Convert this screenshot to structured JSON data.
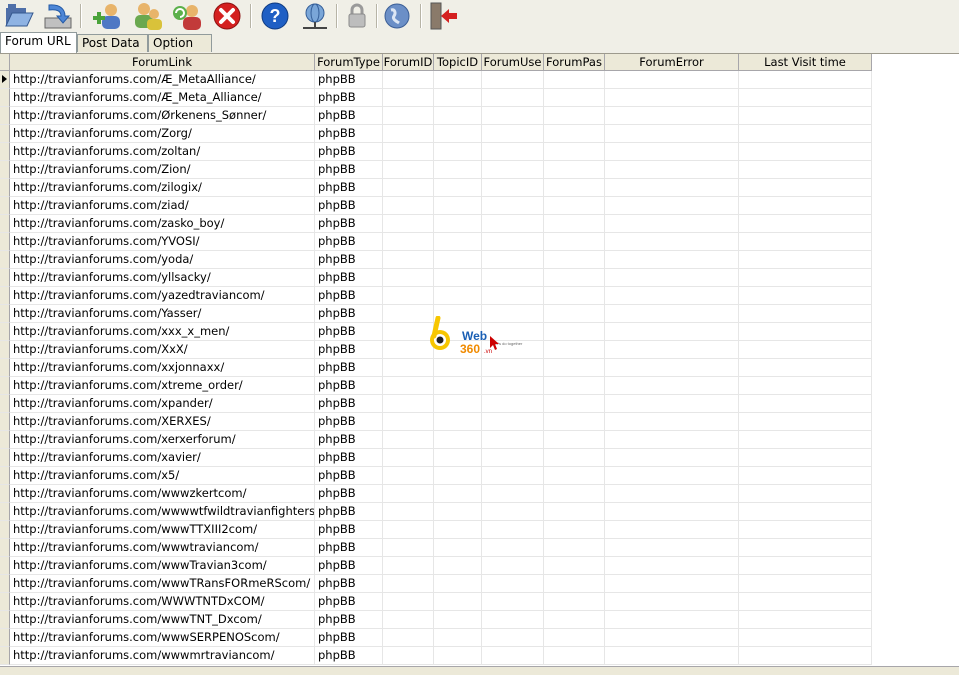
{
  "toolbar": {
    "buttons": [
      {
        "name": "open-folder-button",
        "icon": "open-folder-icon"
      },
      {
        "name": "save-download-button",
        "icon": "download-icon"
      },
      {
        "name": "add-user-button",
        "icon": "add-user-icon"
      },
      {
        "name": "users-group-button",
        "icon": "users-group-icon"
      },
      {
        "name": "refresh-user-button",
        "icon": "refresh-user-icon"
      },
      {
        "name": "stop-button",
        "icon": "stop-icon"
      },
      {
        "name": "help-button",
        "icon": "help-icon"
      },
      {
        "name": "network-button",
        "icon": "network-icon"
      },
      {
        "name": "lock-button",
        "icon": "lock-icon"
      },
      {
        "name": "globe-button",
        "icon": "globe-icon"
      },
      {
        "name": "exit-button",
        "icon": "exit-icon"
      }
    ]
  },
  "tabs": [
    {
      "label": "Forum URL",
      "active": true
    },
    {
      "label": "Post Data",
      "active": false
    },
    {
      "label": "Option",
      "active": false
    }
  ],
  "grid": {
    "columns": [
      "ForumLink",
      "ForumType",
      "ForumID",
      "TopicID",
      "ForumUse",
      "ForumPas",
      "ForumError",
      "Last Visit time"
    ],
    "rows": [
      [
        "http://travianforums.com/Æ_MetaAlliance/",
        "phpBB"
      ],
      [
        "http://travianforums.com/Æ_Meta_Alliance/",
        "phpBB"
      ],
      [
        "http://travianforums.com/Ørkenens_Sønner/",
        "phpBB"
      ],
      [
        "http://travianforums.com/Zorg/",
        "phpBB"
      ],
      [
        "http://travianforums.com/zoltan/",
        "phpBB"
      ],
      [
        "http://travianforums.com/Zion/",
        "phpBB"
      ],
      [
        "http://travianforums.com/zilogix/",
        "phpBB"
      ],
      [
        "http://travianforums.com/ziad/",
        "phpBB"
      ],
      [
        "http://travianforums.com/zasko_boy/",
        "phpBB"
      ],
      [
        "http://travianforums.com/YVOSI/",
        "phpBB"
      ],
      [
        "http://travianforums.com/yoda/",
        "phpBB"
      ],
      [
        "http://travianforums.com/yllsacky/",
        "phpBB"
      ],
      [
        "http://travianforums.com/yazedtraviancom/",
        "phpBB"
      ],
      [
        "http://travianforums.com/Yasser/",
        "phpBB"
      ],
      [
        "http://travianforums.com/xxx_x_men/",
        "phpBB"
      ],
      [
        "http://travianforums.com/XxX/",
        "phpBB"
      ],
      [
        "http://travianforums.com/xxjonnaxx/",
        "phpBB"
      ],
      [
        "http://travianforums.com/xtreme_order/",
        "phpBB"
      ],
      [
        "http://travianforums.com/xpander/",
        "phpBB"
      ],
      [
        "http://travianforums.com/XERXES/",
        "phpBB"
      ],
      [
        "http://travianforums.com/xerxerforum/",
        "phpBB"
      ],
      [
        "http://travianforums.com/xavier/",
        "phpBB"
      ],
      [
        "http://travianforums.com/x5/",
        "phpBB"
      ],
      [
        "http://travianforums.com/wwwzkertcom/",
        "phpBB"
      ],
      [
        "http://travianforums.com/wwwwtfwildtravianfightersr",
        "phpBB"
      ],
      [
        "http://travianforums.com/wwwTTXIII2com/",
        "phpBB"
      ],
      [
        "http://travianforums.com/wwwtraviancom/",
        "phpBB"
      ],
      [
        "http://travianforums.com/wwwTravian3com/",
        "phpBB"
      ],
      [
        "http://travianforums.com/wwwTRansFORmeRScom/",
        "phpBB"
      ],
      [
        "http://travianforums.com/WWWTNTDxCOM/",
        "phpBB"
      ],
      [
        "http://travianforums.com/wwwTNT_Dxcom/",
        "phpBB"
      ],
      [
        "http://travianforums.com/wwwSERPENOScom/",
        "phpBB"
      ],
      [
        "http://travianforums.com/wwwmrtraviancom/",
        "phpBB"
      ]
    ]
  },
  "watermark": {
    "text1": "Web",
    "text2": "360",
    "suffix": ".vn",
    "tagline": "let's do together"
  }
}
